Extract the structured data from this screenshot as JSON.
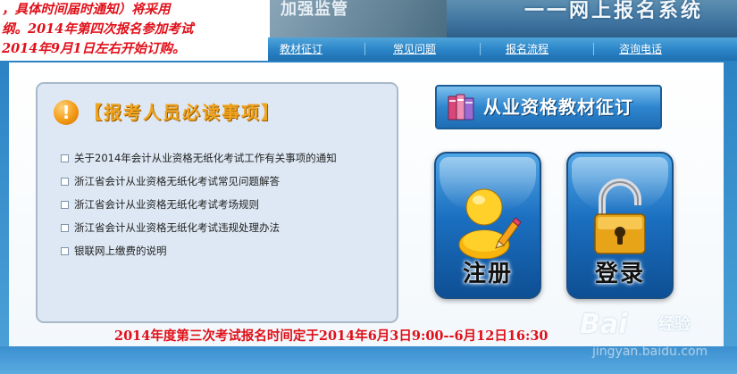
{
  "notice": {
    "lines": [
      "，具体时间届时通知）将采用",
      "纲。2014年第四次报名参加考试",
      "2014年9月1日左右开始订购。"
    ],
    "color": "#e0101a"
  },
  "banner": {
    "left_text": "加强监管",
    "right_text": "一一网上报名系统"
  },
  "nav": {
    "items": [
      {
        "label": "教材征订"
      },
      {
        "label": "常见问题"
      },
      {
        "label": "报名流程"
      },
      {
        "label": "咨询电话"
      }
    ]
  },
  "panel": {
    "icon": "exclamation-icon",
    "title": "【报考人员必读事项】",
    "items": [
      {
        "text": "关于2014年会计从业资格无纸化考试工作有关事项的通知"
      },
      {
        "text": "浙江省会计从业资格无纸化考试常见问题解答"
      },
      {
        "text": "浙江省会计从业资格无纸化考试考场规则"
      },
      {
        "text": "浙江省会计从业资格无纸化考试违规处理办法"
      },
      {
        "text": "银联网上缴费的说明"
      }
    ]
  },
  "order_button": {
    "icon": "books-icon",
    "label": "从业资格教材征订"
  },
  "register_tile": {
    "icon": "user-pencil-icon",
    "label": "注册"
  },
  "login_tile": {
    "icon": "padlock-icon",
    "label": "登录"
  },
  "exam_time": {
    "text": "2014年度第三次考试报名时间定于2014年6月3日9:00--6月12日16:30"
  },
  "watermark": {
    "brand": "Bai",
    "brand_suffix": "经验",
    "url": "jingyan.baidu.com"
  },
  "colors": {
    "accent_blue": "#2c86c8",
    "title_orange": "#f0a520",
    "notice_red": "#e0101a"
  }
}
